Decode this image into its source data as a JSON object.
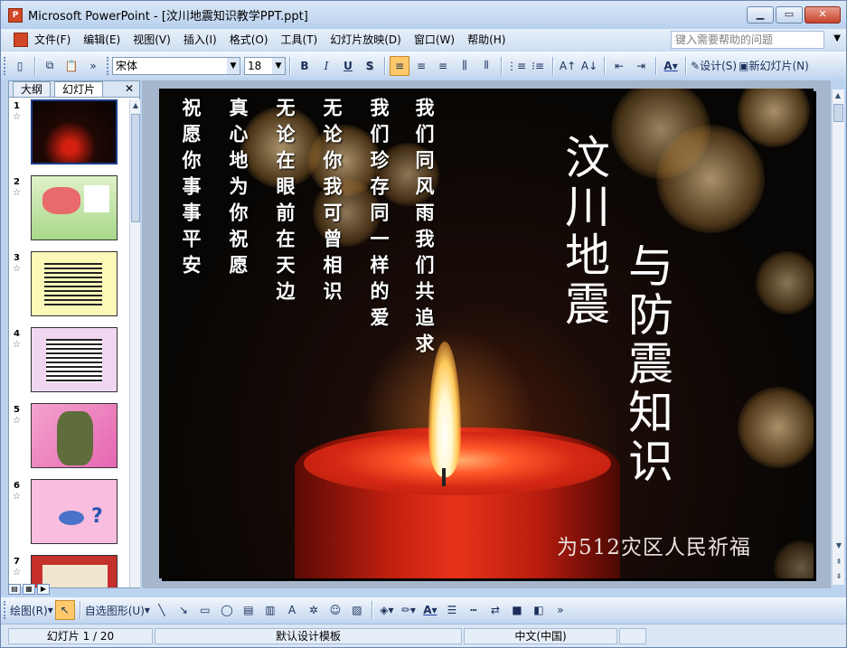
{
  "window": {
    "title": "Microsoft PowerPoint - [汶川地震知识教学PPT.ppt]",
    "app_icon": "powerpoint-icon"
  },
  "menu": {
    "items": [
      "文件(F)",
      "编辑(E)",
      "视图(V)",
      "插入(I)",
      "格式(O)",
      "工具(T)",
      "幻灯片放映(D)",
      "窗口(W)",
      "帮助(H)"
    ],
    "help_placeholder": "键入需要帮助的问题"
  },
  "toolbar": {
    "font": "宋体",
    "size": "18",
    "bold": "B",
    "italic": "I",
    "underline": "U",
    "shadow": "S",
    "design": "设计(S)",
    "new_slide": "新幻灯片(N)"
  },
  "panes": {
    "tab_outline": "大纲",
    "tab_slides": "幻灯片"
  },
  "thumbnails": [
    {
      "num": "1",
      "star": "☆"
    },
    {
      "num": "2",
      "star": "☆"
    },
    {
      "num": "3",
      "star": "☆"
    },
    {
      "num": "4",
      "star": "☆"
    },
    {
      "num": "5",
      "star": "☆"
    },
    {
      "num": "6",
      "star": "☆"
    },
    {
      "num": "7",
      "star": "☆"
    }
  ],
  "slide": {
    "title_col1": "汶川地震",
    "title_col2": "与防震知识",
    "poem": [
      "我们同风雨我们共追求",
      "我们珍存同一样的爱",
      "无论你我可曾相识",
      "无论在眼前在天边",
      "真心地为你祝愿",
      "祝愿你事事平安"
    ],
    "subtitle": "为512灾区人民祈福"
  },
  "drawing": {
    "draw": "绘图(R)",
    "autoshapes": "自选图形(U)"
  },
  "status": {
    "slide": "幻灯片 1 / 20",
    "template": "默认设计模板",
    "language": "中文(中国)"
  }
}
